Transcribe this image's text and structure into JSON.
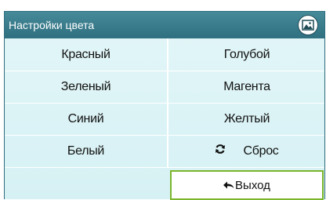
{
  "header": {
    "title": "Настройки цвета",
    "icon": "picture-icon"
  },
  "colors": {
    "red": "Красный",
    "cyan": "Голубой",
    "green": "Зеленый",
    "magenta": "Магента",
    "blue": "Синий",
    "yellow": "Желтый",
    "white": "Белый",
    "reset": "Сброс"
  },
  "footer": {
    "exit": "Выход",
    "selected": "exit"
  },
  "theme": {
    "titlebar": "#2f6f80",
    "panel": "#d6f1f4",
    "highlight": "#7ab52b"
  }
}
